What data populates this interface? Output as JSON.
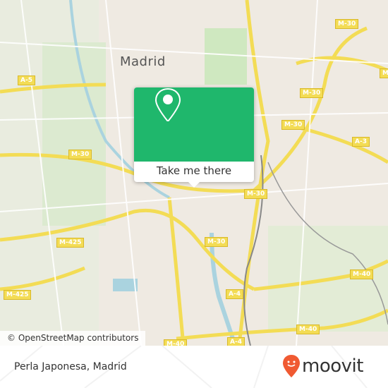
{
  "map": {
    "city_label": "Madrid",
    "road_labels": [
      "M-30",
      "M-30",
      "M-30",
      "M-30",
      "M-30",
      "M-30",
      "A-5",
      "M-425",
      "M-425",
      "A-3",
      "M-40",
      "M-40",
      "M-40",
      "A-4",
      "A-4",
      "M-"
    ],
    "attribution": "© OpenStreetMap contributors",
    "colors": {
      "background": "#efeae2",
      "roads": "#f3dc55",
      "park": "#cfe8c0",
      "water": "#aad3df"
    }
  },
  "popup": {
    "icon": "map-pin-icon",
    "button_label": "Take me there",
    "color": "#1fb76c"
  },
  "footer": {
    "place_name": "Perla Japonesa, Madrid",
    "logo_text": "moovit",
    "logo_color": "#f05a32"
  }
}
